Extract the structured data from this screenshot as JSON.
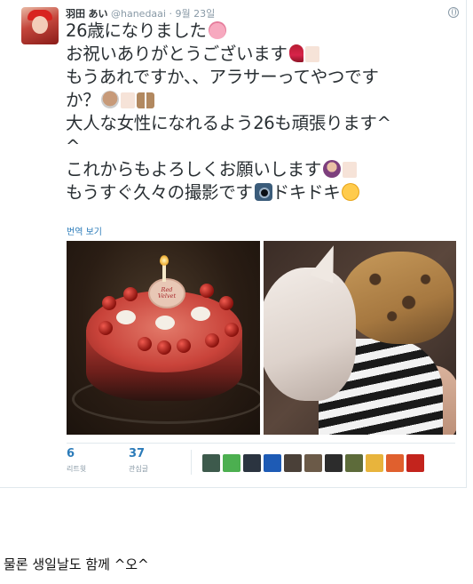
{
  "tweet": {
    "display_name": "羽田",
    "name_suffix": "あい",
    "handle": "@hanedaai",
    "separator": "·",
    "timestamp": "9월 23일",
    "lines": [
      "26歳になりました",
      "お祝いありがとうございます",
      "もうあれですか、、アラサーってやつです",
      "か？",
      "大人な女性になれるよう26も頑張ります^",
      "^",
      "これからもよろしくお願いします",
      "もうすぐ久々の撮影です",
      "ドキドキ"
    ],
    "translate_label": "번역 보기",
    "photos": [
      "birthday-cake-photo",
      "cats-photo"
    ],
    "cake_plaque": [
      "Red",
      "Velvet"
    ],
    "retweets": {
      "count": "6",
      "label": "리트윗"
    },
    "likes": {
      "count": "37",
      "label": "관심글"
    },
    "liker_avatar_colors": [
      "#3d5a4c",
      "#4caf50",
      "#2b3440",
      "#1e5bb5",
      "#4a4038",
      "#6b5a48",
      "#2c2c2c",
      "#5d6b3a",
      "#e8b43c",
      "#e0602e",
      "#c3241d"
    ]
  },
  "caption": "물론 생일날도 함께 ^오^"
}
